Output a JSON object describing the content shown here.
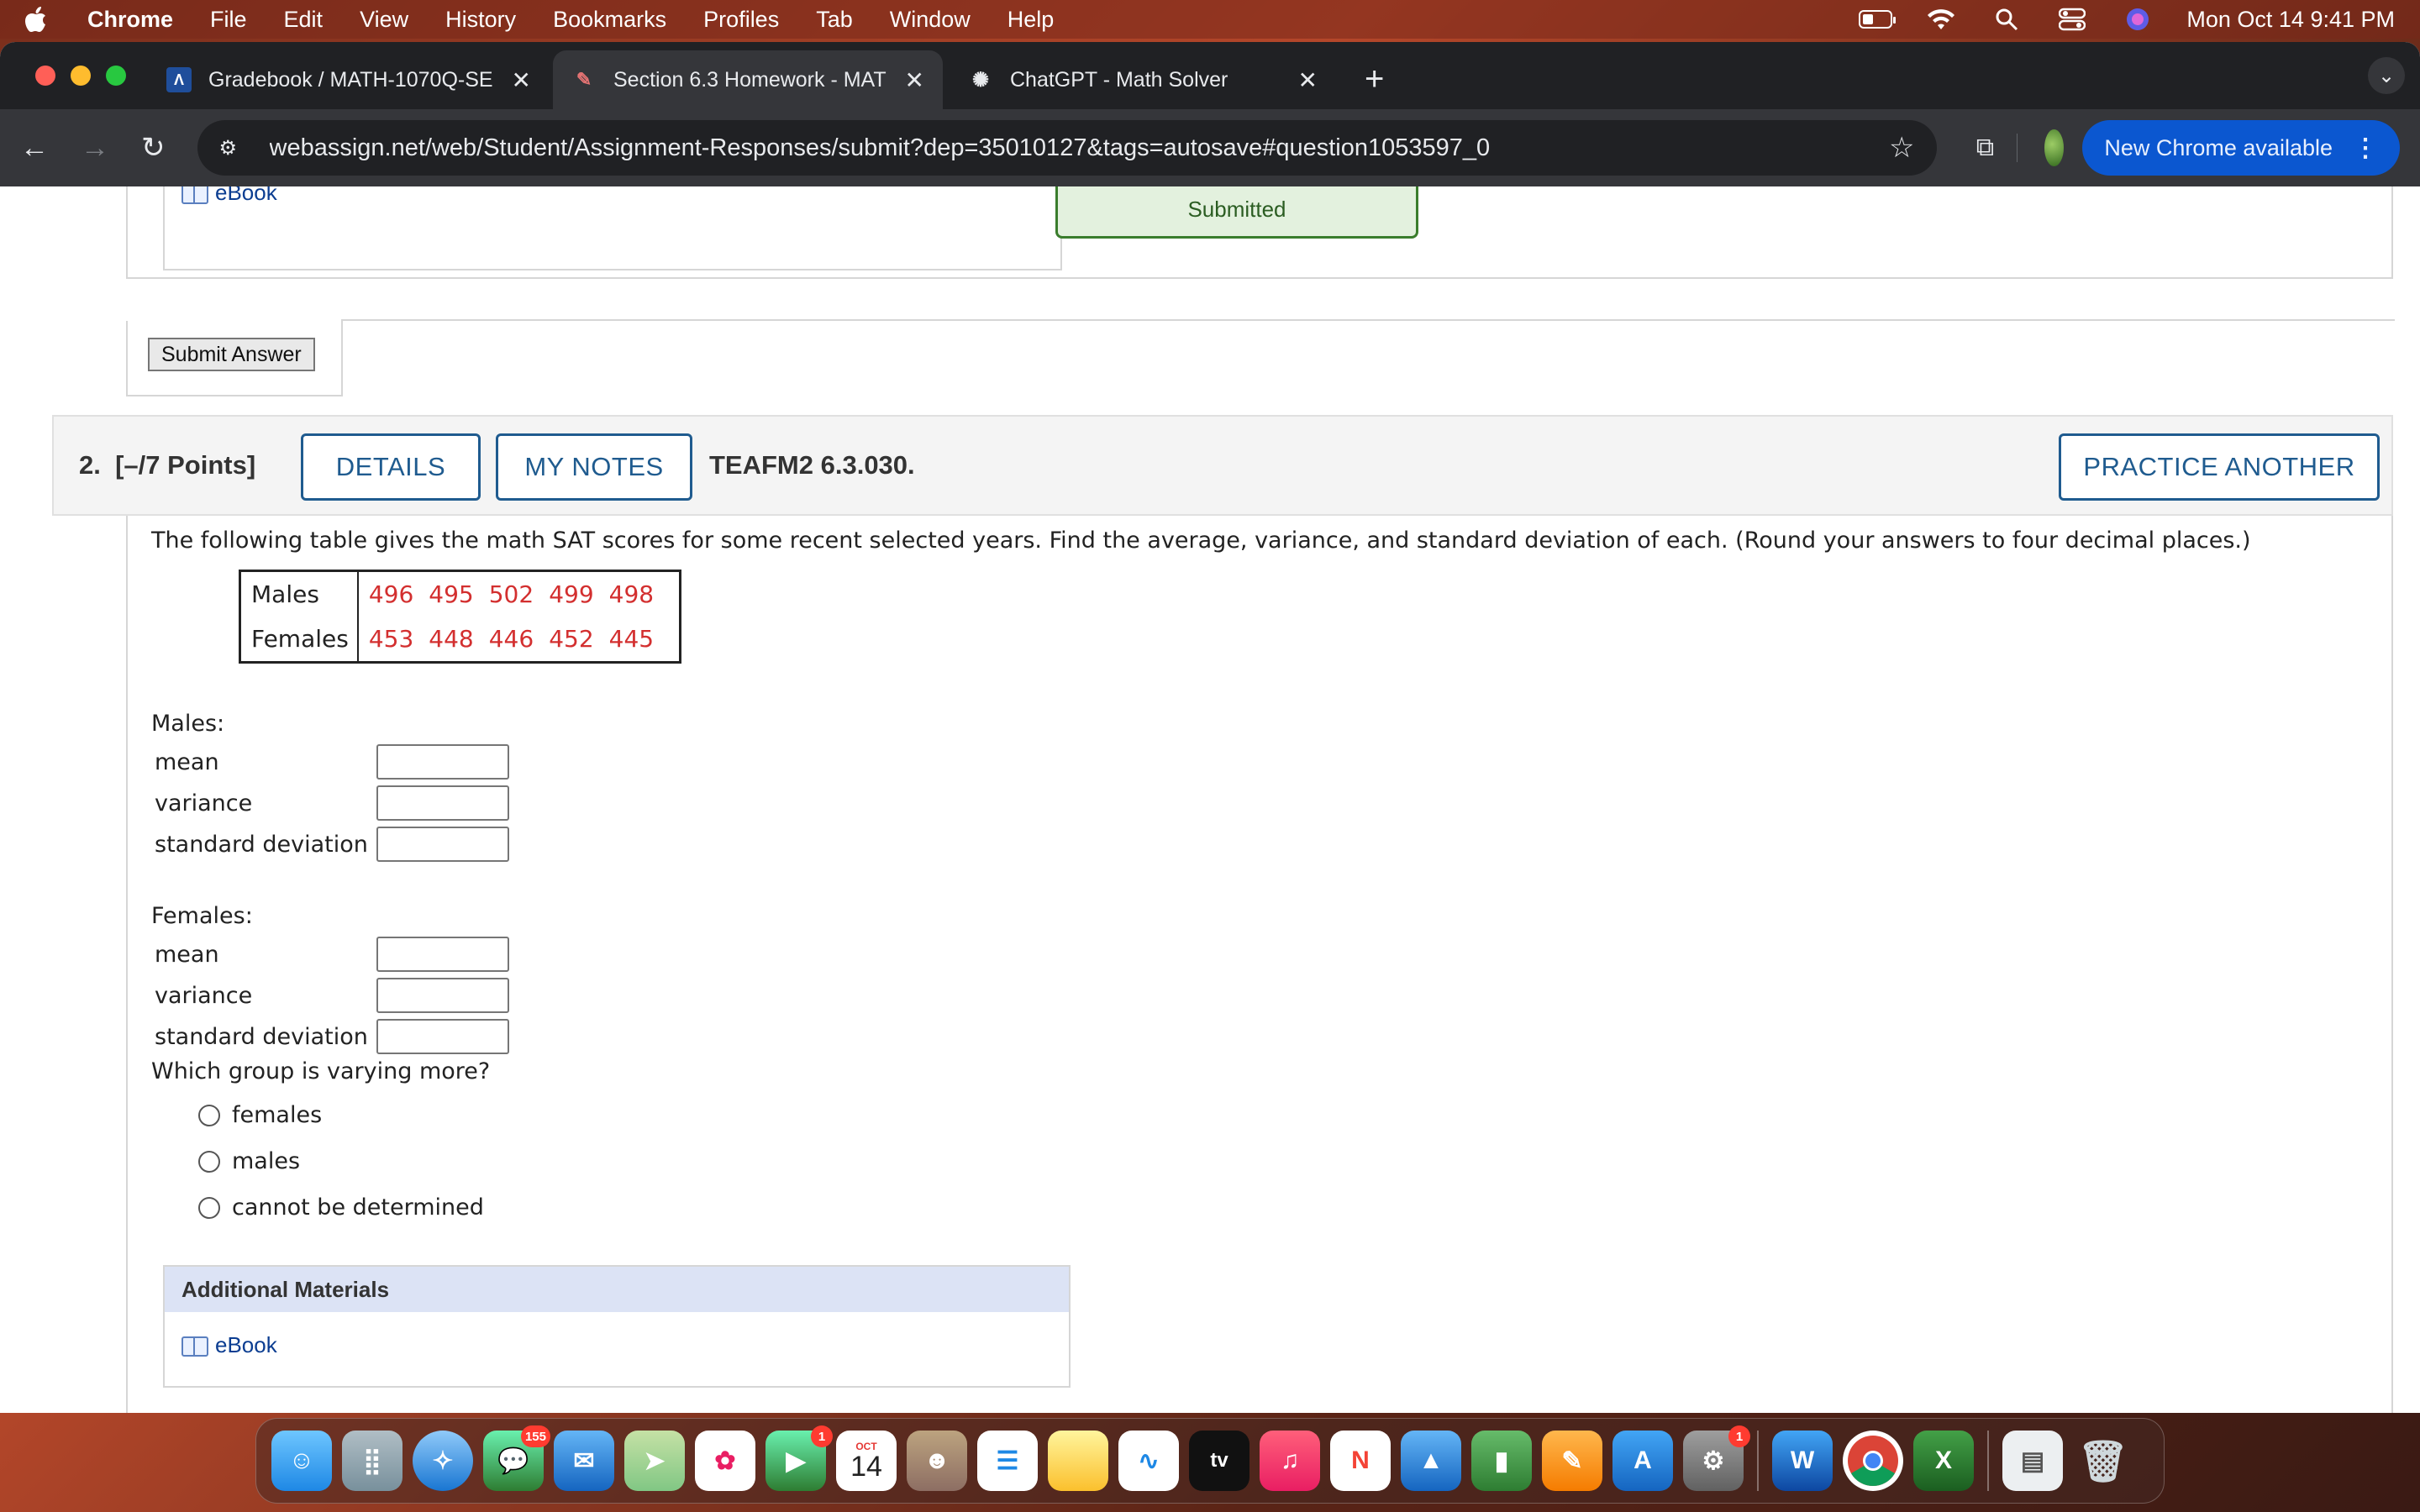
{
  "menubar": {
    "app": "Chrome",
    "items": [
      "File",
      "Edit",
      "View",
      "History",
      "Bookmarks",
      "Profiles",
      "Tab",
      "Window",
      "Help"
    ],
    "datetime": "Mon Oct 14  9:41 PM"
  },
  "tabs": [
    {
      "title": "Gradebook / MATH-1070Q-SE",
      "icon": "gradebook-icon"
    },
    {
      "title": "Section 6.3 Homework - MAT",
      "icon": "webassign-icon"
    },
    {
      "title": "ChatGPT - Math Solver",
      "icon": "chatgpt-icon"
    }
  ],
  "address_bar": {
    "url": "webassign.net/web/Student/Assignment-Responses/submit?dep=35010127&tags=autosave#question1053597_0"
  },
  "update_chip": "New Chrome available",
  "previous_question": {
    "ebook_link": "eBook",
    "status": "Submitted",
    "submit_button": "Submit Answer"
  },
  "question": {
    "number": "2.",
    "points": "[–/7 Points]",
    "details_button": "DETAILS",
    "notes_button": "MY NOTES",
    "code": "TEAFM2 6.3.030.",
    "practice_button": "PRACTICE ANOTHER",
    "prompt": "The following table gives the math SAT scores for some recent selected years. Find the average, variance, and standard deviation of each. (Round your answers to four decimal places.)",
    "table": {
      "rows": [
        {
          "label": "Males",
          "values": [
            "496",
            "495",
            "502",
            "499",
            "498"
          ]
        },
        {
          "label": "Females",
          "values": [
            "453",
            "448",
            "446",
            "452",
            "445"
          ]
        }
      ]
    },
    "males_heading": "Males:",
    "females_heading": "Females:",
    "field_labels": {
      "mean": "mean",
      "variance": "variance",
      "sd": "standard deviation"
    },
    "which_group": "Which group is varying more?",
    "options": [
      "females",
      "males",
      "cannot be determined"
    ]
  },
  "additional_materials": {
    "heading": "Additional Materials",
    "link": "eBook"
  },
  "dock": {
    "badges": {
      "messages": "155",
      "facetime": "1",
      "settings": "1"
    },
    "calendar_month": "OCT",
    "calendar_day": "14"
  },
  "colors": {
    "accent_blue": "#1f5b8f",
    "table_value_red": "#d32f2f",
    "submitted_green": "#3a7d2c",
    "chip_blue": "#0b57d0"
  }
}
